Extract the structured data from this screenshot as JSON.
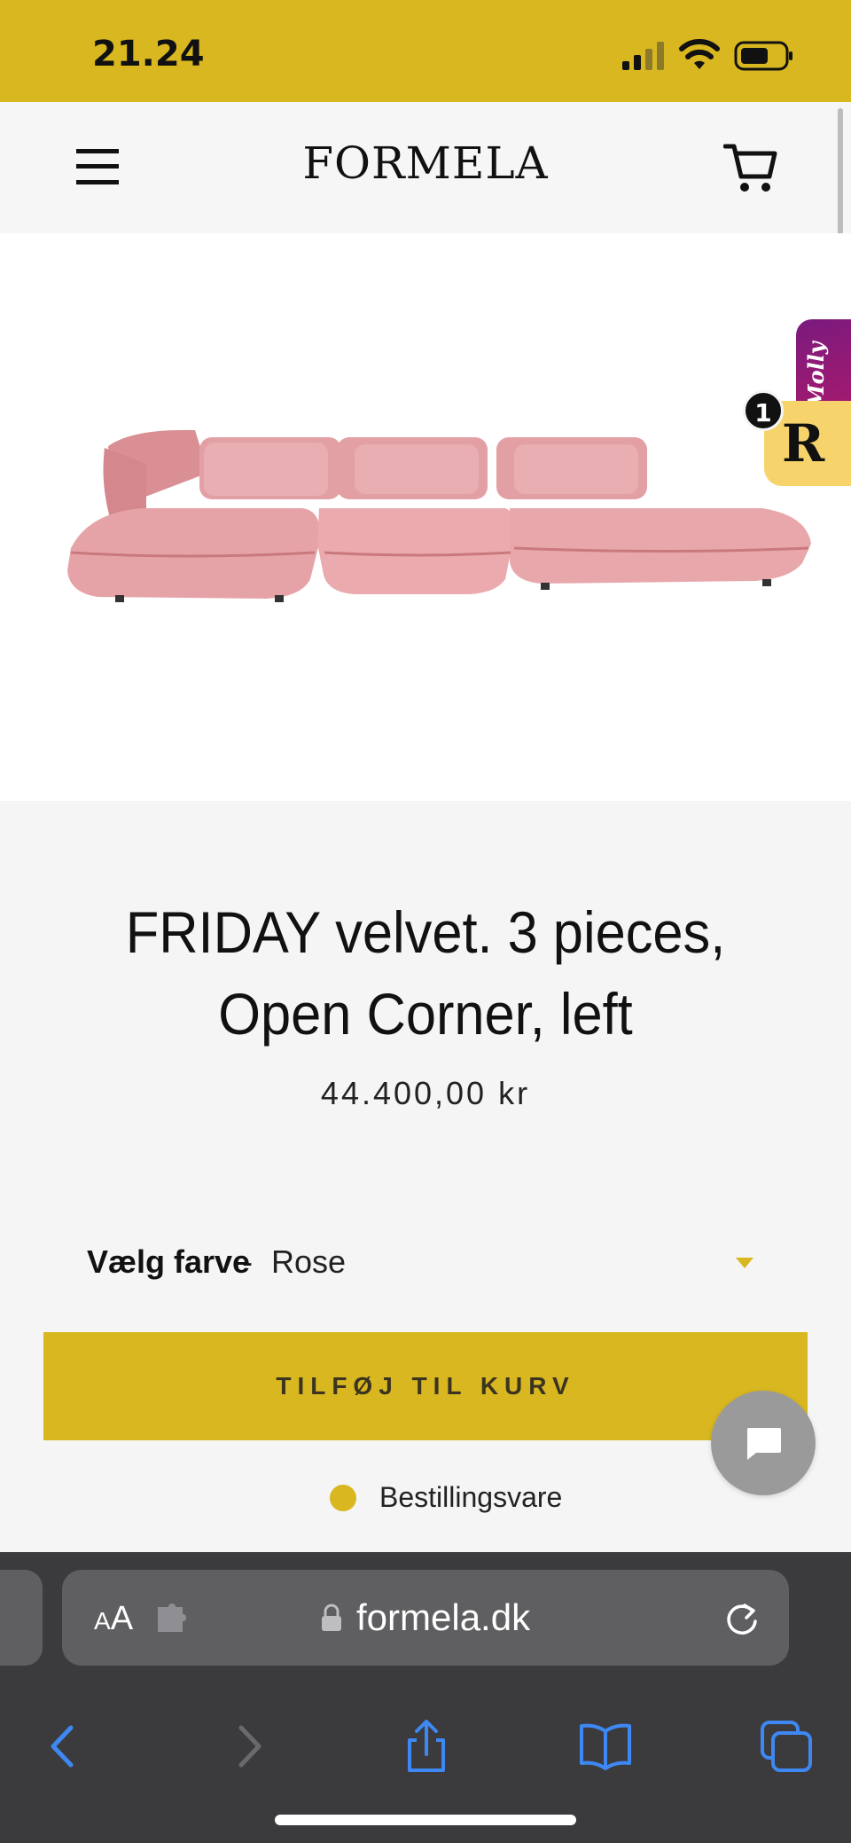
{
  "status_bar": {
    "time": "21.24"
  },
  "header": {
    "logo": "FORMELA",
    "menu_icon": "hamburger-menu-icon",
    "cart_icon": "shopping-cart-icon"
  },
  "widgets": {
    "molly_label": "Molly",
    "reward_badge_count": "1",
    "reward_glyph": "R"
  },
  "product": {
    "title": "FRIDAY velvet. 3 pieces, Open Corner, left",
    "price": "44.400,00 kr",
    "variant_label": "Vælg farve",
    "variant_separator": "-",
    "variant_value": "Rose",
    "add_to_cart_label": "TILFØJ TIL KURV",
    "availability": "Bestillingsvare",
    "sofa_color": "#e8a5a8"
  },
  "browser": {
    "aa_small": "A",
    "aa_big": "A",
    "url": "formela.dk",
    "icons": [
      "back-icon",
      "forward-icon",
      "share-icon",
      "bookmarks-icon",
      "tabs-icon"
    ]
  },
  "colors": {
    "accent": "#d8b720",
    "page_bg": "#f5f5f5",
    "browser_bg": "#3b3b3d",
    "ios_blue": "#3e88f3"
  }
}
